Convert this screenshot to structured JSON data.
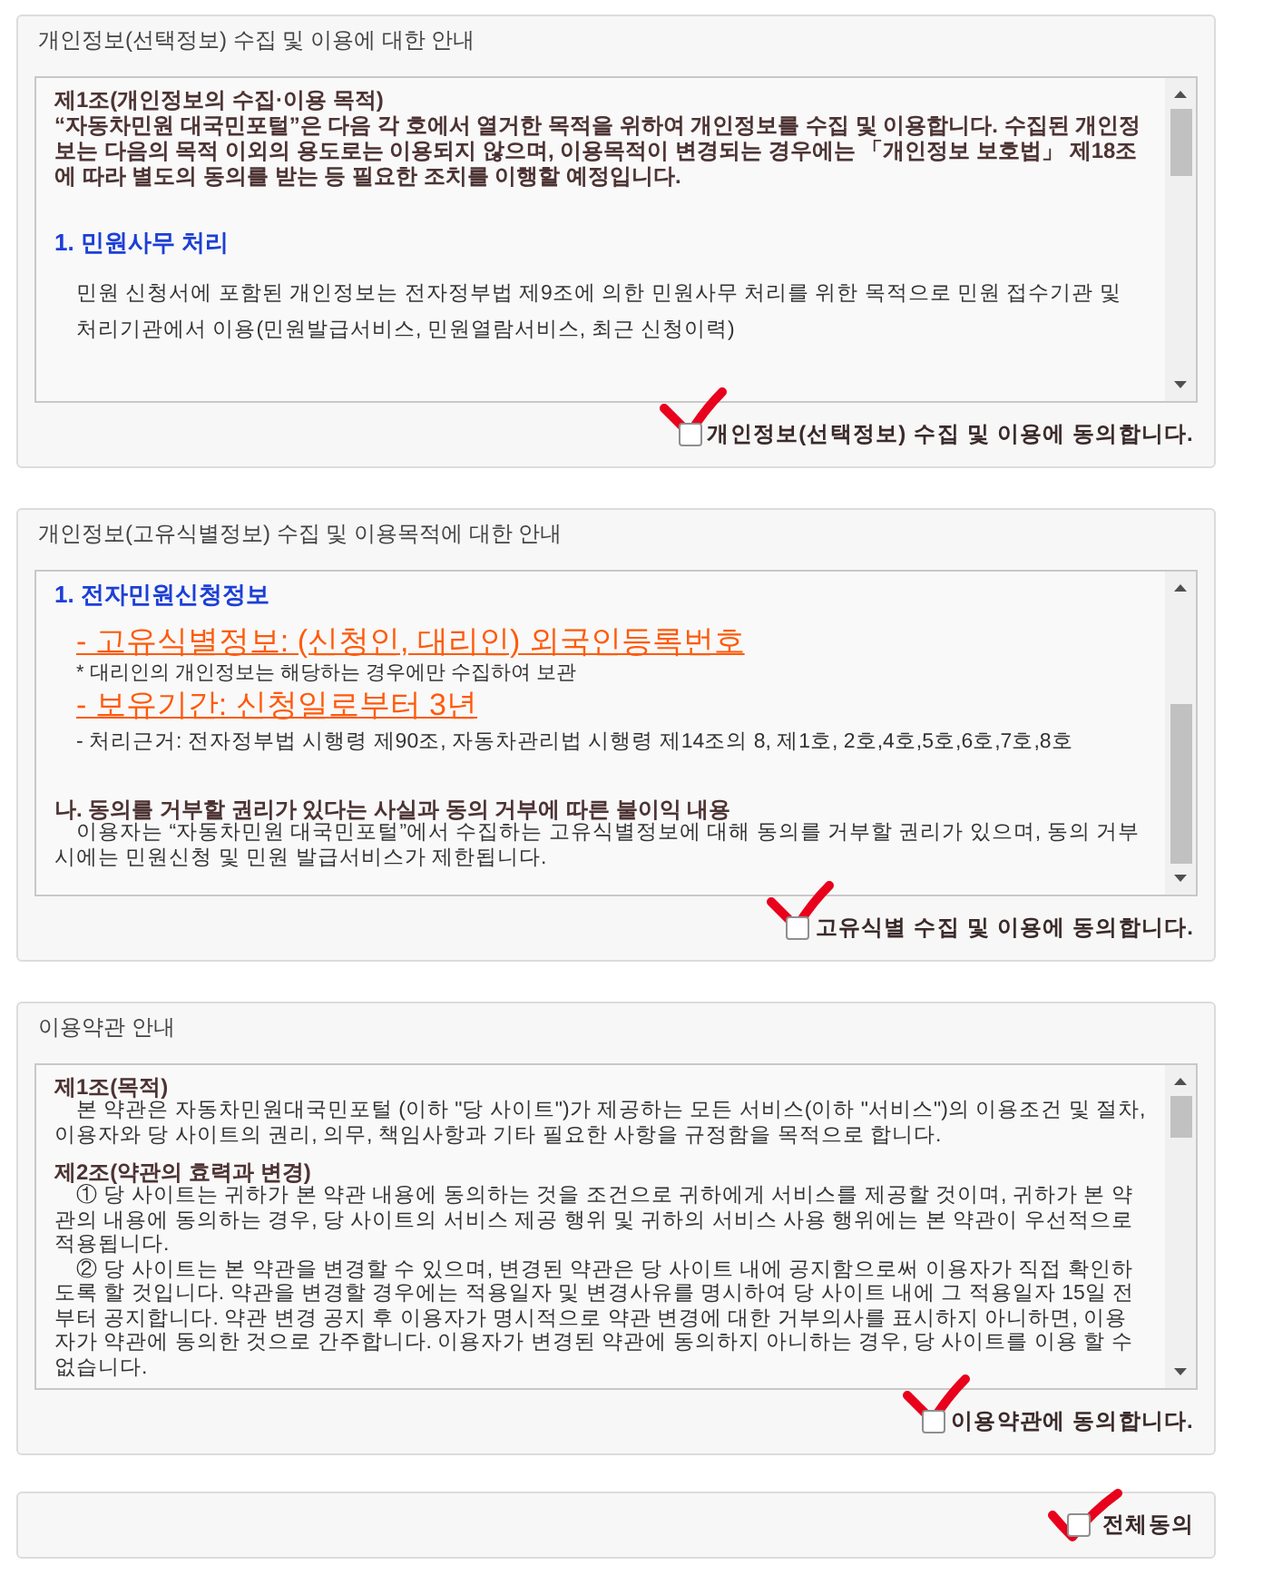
{
  "sections": [
    {
      "title": "개인정보(선택정보) 수집 및 이용에 대한 안내",
      "content": [
        {
          "kind": "article_heading",
          "text": "제1조(개인정보의 수집·이용 목적)"
        },
        {
          "kind": "article_bold",
          "text": "“자동차민원 대국민포털”은 다음 각 호에서 열거한 목적을 위하여 개인정보를 수집 및 이용합니다. 수집된 개인정보는 다음의 목적 이외의 용도로는 이용되지 않으며, 이용목적이 변경되는 경우에는 「개인정보 보호법」 제18조에 따라 별도의 동의를 받는 등 필요한 조치를 이행할 예정입니다."
        },
        {
          "kind": "list_heading",
          "text": "1. 민원사무 처리"
        },
        {
          "kind": "indented",
          "text": "민원 신청서에 포함된 개인정보는 전자정부법 제9조에 의한 민원사무 처리를 위한 목적으로 민원 접수기관 및 처리기관에서 이용(민원발급서비스, 민원열람서비스, 최근 신청이력)"
        }
      ],
      "agreement": {
        "label": "개인정보(선택정보) 수집 및 이용에 동의합니다.",
        "checked": false,
        "tick_annotation": true
      }
    },
    {
      "title": "개인정보(고유식별정보) 수집 및 이용목적에 대한 안내",
      "content": [
        {
          "kind": "list_heading",
          "text": "1. 전자민원신청정보"
        },
        {
          "kind": "highlight",
          "text": "- 고유식별정보: (신청인, 대리인) 외국인등록번호"
        },
        {
          "kind": "note",
          "text": "* 대리인의 개인정보는 해당하는 경우에만 수집하여 보관"
        },
        {
          "kind": "highlight",
          "text": "- 보유기간: 신청일로부터 3년"
        },
        {
          "kind": "detail",
          "text": "- 처리근거: 전자정부법 시행령 제90조, 자동차관리법 시행령 제14조의 8, 제1호, 2호,4호,5호,6호,7호,8호"
        },
        {
          "kind": "article_heading",
          "text": "나. 동의를 거부할 권리가 있다는 사실과 동의 거부에 따른 불이익 내용"
        },
        {
          "kind": "body",
          "text": "이용자는 “자동차민원 대국민포털”에서 수집하는 고유식별정보에 대해 동의를 거부할 권리가 있으며, 동의 거부시에는 민원신청 및 민원 발급서비스가 제한됩니다."
        }
      ],
      "agreement": {
        "label": "고유식별 수집 및 이용에 동의합니다.",
        "checked": false,
        "tick_annotation": true
      }
    },
    {
      "title": "이용약관 안내",
      "content": [
        {
          "kind": "article_heading",
          "text": "제1조(목적)"
        },
        {
          "kind": "body",
          "text": "본 약관은 자동차민원대국민포털 (이하 \"당 사이트\")가 제공하는 모든 서비스(이하 \"서비스\")의 이용조건 및 절차, 이용자와 당 사이트의 권리, 의무, 책임사항과 기타 필요한 사항을 규정함을 목적으로 합니다."
        },
        {
          "kind": "article_heading",
          "text": "제2조(약관의 효력과 변경)"
        },
        {
          "kind": "body",
          "text": "① 당 사이트는 귀하가 본 약관 내용에 동의하는 것을 조건으로 귀하에게 서비스를 제공할 것이며, 귀하가 본 약관의 내용에 동의하는 경우, 당 사이트의 서비스 제공 행위 및 귀하의 서비스 사용 행위에는 본 약관이 우선적으로 적용됩니다."
        },
        {
          "kind": "body",
          "text": "② 당 사이트는 본 약관을 변경할 수 있으며, 변경된 약관은 당 사이트 내에 공지함으로써 이용자가 직접 확인하도록 할 것입니다. 약관을 변경할 경우에는 적용일자 및 변경사유를 명시하여 당 사이트 내에 그 적용일자 15일 전부터 공지합니다. 약관 변경 공지 후 이용자가 명시적으로 약관 변경에 대한 거부의사를 표시하지 아니하면, 이용자가 약관에 동의한 것으로 간주합니다. 이용자가 변경된 약관에 동의하지 아니하는 경우, 당 사이트를 이용 할 수 없습니다."
        }
      ],
      "agreement": {
        "label": "이용약관에 동의합니다.",
        "checked": false,
        "tick_annotation": true
      }
    }
  ],
  "all_agree": {
    "label": "전체동의",
    "checked": false,
    "tick_annotation": true
  }
}
